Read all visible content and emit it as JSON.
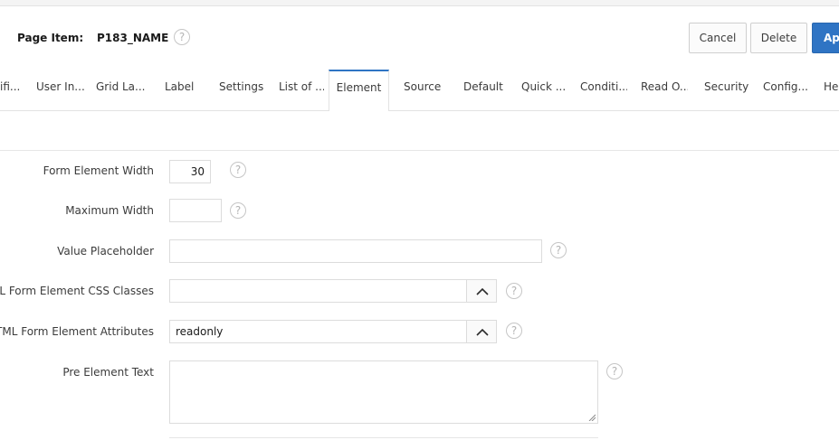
{
  "header": {
    "page_item_label": "Page Item:",
    "page_item_value": "P183_NAME",
    "help_symbol": "?",
    "buttons": {
      "cancel": "Cancel",
      "delete": "Delete",
      "apply": "Ap"
    }
  },
  "tabs": [
    {
      "label": "ifi..."
    },
    {
      "label": "User In..."
    },
    {
      "label": "Grid La..."
    },
    {
      "label": "Label"
    },
    {
      "label": "Settings"
    },
    {
      "label": "List of ..."
    },
    {
      "label": "Element",
      "active": true
    },
    {
      "label": "Source"
    },
    {
      "label": "Default"
    },
    {
      "label": "Quick ..."
    },
    {
      "label": "Conditi..."
    },
    {
      "label": "Read O..."
    },
    {
      "label": "Security"
    },
    {
      "label": "Config..."
    },
    {
      "label": "He"
    }
  ],
  "form": {
    "form_element_width": {
      "label": "Form Element Width",
      "value": "30"
    },
    "maximum_width": {
      "label": "Maximum Width",
      "value": ""
    },
    "value_placeholder": {
      "label": "Value Placeholder",
      "value": ""
    },
    "css_classes": {
      "label": "ML Form Element CSS Classes",
      "value": ""
    },
    "element_attributes": {
      "label": "TML Form Element Attributes",
      "value": "readonly"
    },
    "pre_element_text": {
      "label": "Pre Element Text",
      "value": ""
    }
  },
  "icons": {
    "help": "help-circle-icon",
    "chevron_up": "chevron-up-icon",
    "resize": "resize-grip-icon"
  },
  "colors": {
    "accent": "#2f74c4",
    "border": "#dcdcdc"
  }
}
